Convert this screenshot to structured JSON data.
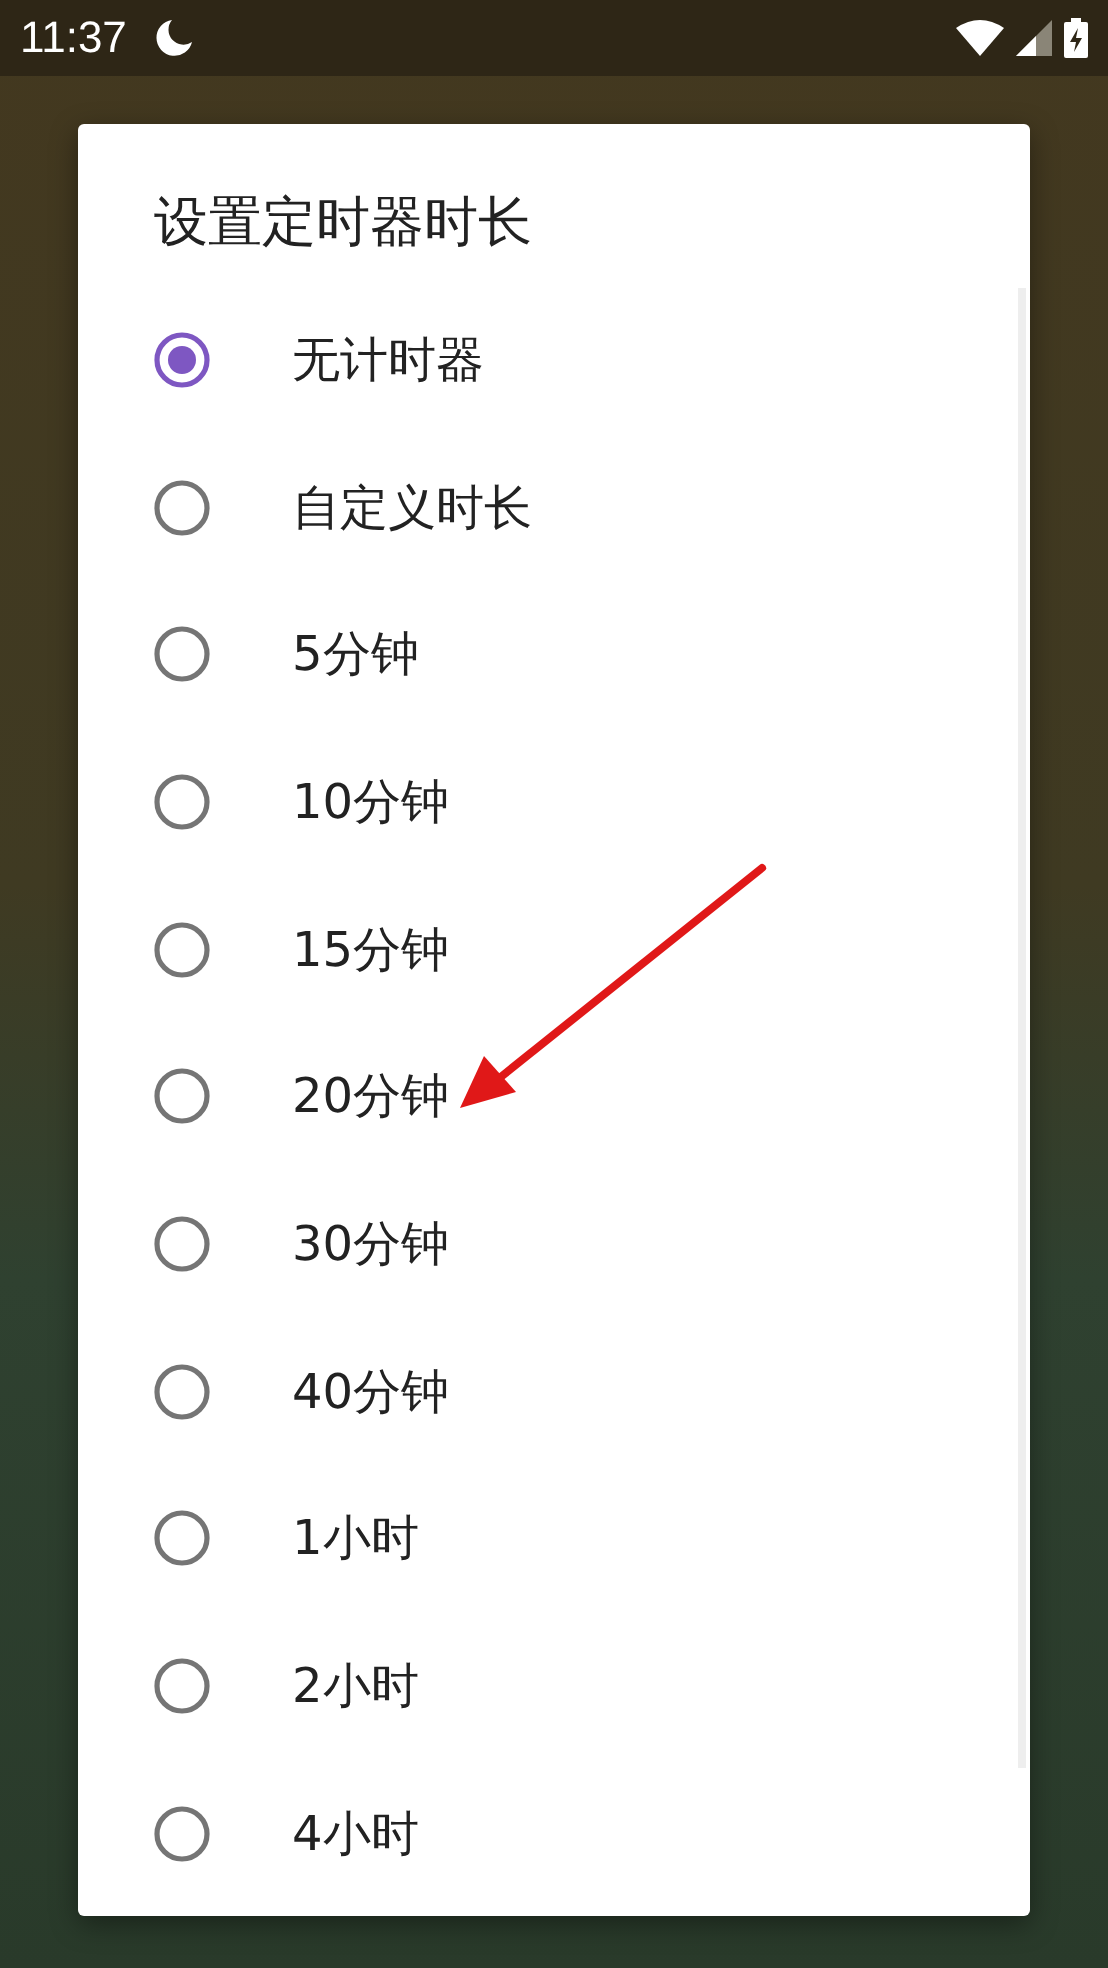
{
  "status_bar": {
    "time": "11:37"
  },
  "dialog": {
    "title": "设置定时器时长",
    "options": [
      {
        "label": "无计时器",
        "selected": true
      },
      {
        "label": "自定义时长",
        "selected": false
      },
      {
        "label": "5分钟",
        "selected": false
      },
      {
        "label": "10分钟",
        "selected": false
      },
      {
        "label": "15分钟",
        "selected": false
      },
      {
        "label": "20分钟",
        "selected": false
      },
      {
        "label": "30分钟",
        "selected": false
      },
      {
        "label": "40分钟",
        "selected": false
      },
      {
        "label": "1小时",
        "selected": false
      },
      {
        "label": "2小时",
        "selected": false
      },
      {
        "label": "4小时",
        "selected": false
      }
    ]
  }
}
